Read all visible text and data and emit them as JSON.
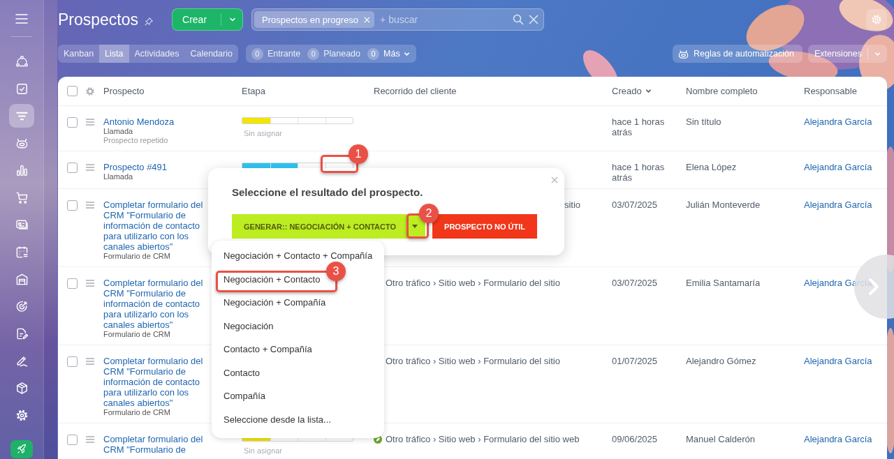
{
  "sidebar": {
    "items": [
      {
        "selected": false
      },
      {
        "selected": false
      },
      {
        "selected": true
      },
      {
        "selected": false
      },
      {
        "selected": false
      },
      {
        "selected": false
      },
      {
        "selected": false
      },
      {
        "selected": false
      },
      {
        "selected": false
      },
      {
        "selected": false
      },
      {
        "selected": false
      },
      {
        "selected": false
      },
      {
        "selected": false
      },
      {
        "selected": false
      }
    ]
  },
  "header": {
    "title": "Prospectos",
    "create": "Crear",
    "filter_chip": "Prospectos en progreso",
    "search": {
      "placeholder": "+ buscar"
    }
  },
  "views": [
    {
      "label": "Kanban",
      "selected": false
    },
    {
      "label": "Lista",
      "selected": true
    },
    {
      "label": "Actividades",
      "selected": false
    },
    {
      "label": "Calendario",
      "selected": false
    }
  ],
  "counters": [
    {
      "kind": "counter",
      "count": "0",
      "label": "Entrante"
    },
    {
      "kind": "counter",
      "count": "0",
      "label": "Planeado"
    },
    {
      "kind": "menu",
      "count": "0",
      "label": "Más"
    }
  ],
  "automation": "Reglas de automatización",
  "extensions": "Extensiones",
  "table": {
    "checked": false,
    "columns": [
      {
        "label": "Prospecto",
        "sorted": false
      },
      {
        "label": "Etapa",
        "sorted": false
      },
      {
        "label": "Recorrido del cliente",
        "sorted": false
      },
      {
        "label": "Creado",
        "sorted": true
      },
      {
        "label": "Nombre completo",
        "sorted": false
      },
      {
        "label": "Responsable",
        "sorted": false
      }
    ],
    "rows": [
      {
        "checked": false,
        "title": "Antonio Mendoza",
        "subs": [
          "Llamada",
          "Prospecto repetido"
        ],
        "stage": {
          "level": 0.25,
          "color": "#f2e500",
          "label": "Sin asignar"
        },
        "created": "hace 1 horas atrás",
        "name": "Sin título",
        "owner": "Alejandra García"
      },
      {
        "checked": false,
        "title": "Prospecto #491",
        "subs": [
          "Llamada"
        ],
        "stage": {
          "level": 0.5,
          "color": "#2fc6f6"
        },
        "created": "hace 1 horas atrás",
        "name": "Elena López",
        "owner": "Alejandra García"
      },
      {
        "checked": false,
        "title": "Completar formulario del CRM \"Formulario de información de contacto para utilizarlo con los canales abiertos\"",
        "subs": [
          "Formulario de CRM"
        ],
        "journey": {
          "partial": true,
          "text": "sitio"
        },
        "created": "03/07/2025",
        "name": "Julián Monteverde",
        "owner": "Alejandra García"
      },
      {
        "checked": false,
        "title": "Completar formulario del CRM \"Formulario de información de contacto para utilizarlo con los canales abiertos\"",
        "subs": [
          "Formulario de CRM"
        ],
        "journey": {
          "partial": false,
          "text": "Otro tráfico › Sitio web › Formulario del sitio"
        },
        "created": "03/07/2025",
        "name": "Emilia Santamaría",
        "owner": "Alejandra García"
      },
      {
        "checked": false,
        "title": "Completar formulario del CRM \"Formulario de información de contacto para utilizarlo con los canales abiertos\"",
        "subs": [
          "Formulario de CRM"
        ],
        "journey": {
          "partial": false,
          "text": "Otro tráfico › Sitio web › Formulario del sitio"
        },
        "created": "01/07/2025",
        "name": "Alejandro Gómez",
        "owner": "Alejandra García"
      },
      {
        "checked": false,
        "title": "Completar formulario del CRM \"Formulario de",
        "subs": [],
        "stage": {
          "level": 0.25,
          "color": "#f2e500",
          "label": "Sin asignar"
        },
        "journey": {
          "partial": false,
          "icon": true,
          "text": "Otro tráfico › Sitio web › Formulario del sitio web"
        },
        "created": "09/06/2025",
        "name": "Manuel Calderón",
        "owner": "Alejandra García"
      }
    ]
  },
  "popup": {
    "title": "Seleccione el resultado del prospecto.",
    "primary": "GENERAR:: NEGOCIACIÓN + CONTACTO",
    "secondary": "PROSPECTO NO ÚTIL"
  },
  "menu": {
    "items": [
      "Negociación + Contacto + Compañía",
      "Negociación + Contacto",
      "Negociación + Compañía",
      "Negociación",
      "Contacto + Compañía",
      "Contacto",
      "Compañía",
      "Seleccione desde la lista..."
    ]
  },
  "callouts": [
    {
      "number": "1"
    },
    {
      "number": "2"
    },
    {
      "number": "3"
    }
  ]
}
